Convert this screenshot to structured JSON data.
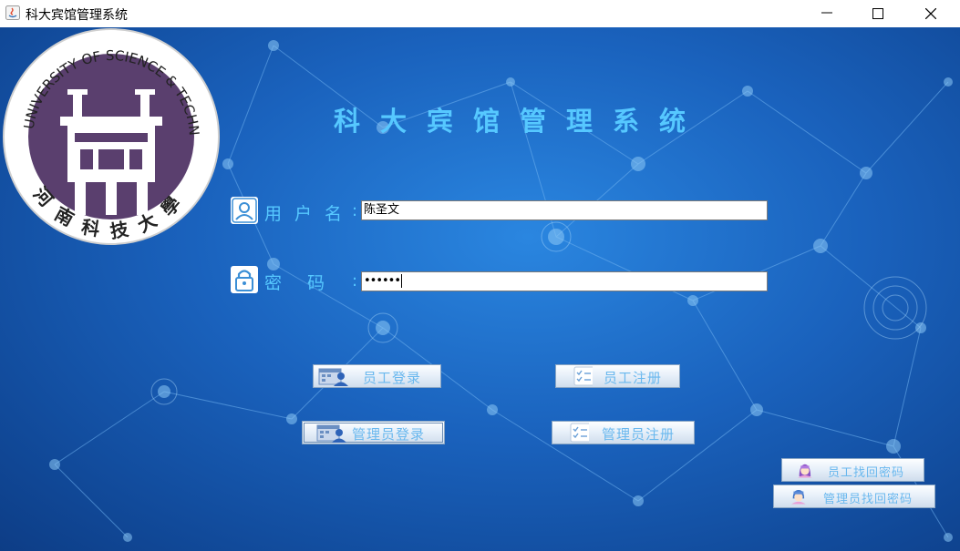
{
  "window": {
    "title": "科大宾馆管理系统",
    "controls": [
      "minimize",
      "maximize",
      "close"
    ]
  },
  "logo": {
    "university_name_en": "HENAN UNIVERSITY OF SCIENCE & TECHNOLOGY",
    "university_name_cn": "河南科技大學"
  },
  "header": {
    "system_title": "科大宾馆管理系统"
  },
  "form": {
    "username": {
      "label": "用户名",
      "colon": ":",
      "value": "陈圣文",
      "icon": "user-icon"
    },
    "password": {
      "label": "密码",
      "colon": ":",
      "masked_value": "••••••",
      "icon": "lock-icon"
    }
  },
  "buttons": {
    "employee_login": "员工登录",
    "employee_register": "员工注册",
    "admin_login": "管理员登录",
    "admin_register": "管理员注册",
    "employee_recover": "员工找回密码",
    "admin_recover": "管理员找回密码"
  },
  "colors": {
    "background": "#1a62bd",
    "label_text": "#56c8ff",
    "button_text": "#6ab8ee",
    "seal_purple": "#5a3f6e"
  }
}
